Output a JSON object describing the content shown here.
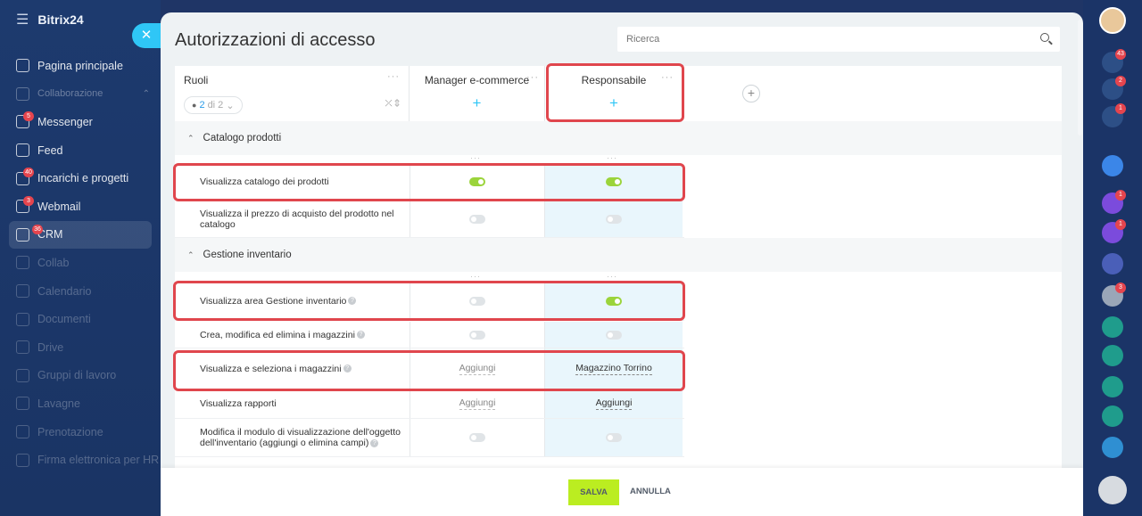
{
  "app": {
    "brand": "Bitrix24"
  },
  "sidebar": {
    "items": [
      {
        "label": "Pagina principale",
        "style": "normal"
      },
      {
        "label": "Collaborazione",
        "style": "section"
      },
      {
        "label": "Messenger",
        "style": "normal",
        "badge": "5"
      },
      {
        "label": "Feed",
        "style": "normal"
      },
      {
        "label": "Incarichi e progetti",
        "style": "normal",
        "badge": "40"
      },
      {
        "label": "Webmail",
        "style": "normal",
        "badge": "3"
      },
      {
        "label": "CRM",
        "style": "active",
        "badge": "36"
      },
      {
        "label": "Collab",
        "style": "dim"
      },
      {
        "label": "Calendario",
        "style": "dim"
      },
      {
        "label": "Documenti",
        "style": "dim"
      },
      {
        "label": "Drive",
        "style": "dim"
      },
      {
        "label": "Gruppi di lavoro",
        "style": "dim"
      },
      {
        "label": "Lavagne",
        "style": "dim"
      },
      {
        "label": "Prenotazione",
        "style": "dim"
      },
      {
        "label": "Firma elettronica per HR",
        "style": "dim"
      }
    ]
  },
  "rail": {
    "buttons": [
      {
        "name": "notifications",
        "badge": "43",
        "color": "#2d4f86"
      },
      {
        "name": "activity",
        "badge": "2",
        "color": "#2d4f86"
      },
      {
        "name": "chat",
        "badge": "1",
        "color": "#2d4f86"
      },
      {
        "name": "bookmark",
        "badge": "",
        "color": "#3b86e8"
      },
      {
        "name": "app-1",
        "badge": "1",
        "color": "#7b4bdc"
      },
      {
        "name": "app-2",
        "badge": "1",
        "color": "#7b4bdc"
      },
      {
        "name": "app-3",
        "badge": "",
        "color": "#4a5fb8"
      },
      {
        "name": "user-avatar",
        "badge": "3",
        "color": "#9aa6b8"
      },
      {
        "name": "task-1",
        "badge": "",
        "color": "#1f9c8c"
      },
      {
        "name": "task-2",
        "badge": "",
        "color": "#1f9c8c"
      },
      {
        "name": "group-1",
        "badge": "",
        "color": "#1f9c8c"
      },
      {
        "name": "group-2",
        "badge": "",
        "color": "#1f9c8c"
      },
      {
        "name": "comments",
        "badge": "",
        "color": "#2f8fd2"
      }
    ]
  },
  "panel": {
    "title": "Autorizzazioni di accesso",
    "search_placeholder": "Ricerca",
    "roles_header": "Ruoli",
    "roles_counter": {
      "current": "2",
      "rest": "di 2"
    },
    "roles": [
      "Manager e-commerce",
      "Responsabile"
    ]
  },
  "sections": [
    {
      "title": "Catalogo prodotti",
      "rows": [
        {
          "label": "Visualizza catalogo dei prodotti",
          "help": false,
          "c1": {
            "type": "toggle",
            "on": true
          },
          "c2": {
            "type": "toggle",
            "on": true
          }
        },
        {
          "label": "Visualizza il prezzo di acquisto del prodotto nel catalogo",
          "help": false,
          "c1": {
            "type": "toggle",
            "on": false
          },
          "c2": {
            "type": "toggle",
            "on": false
          }
        }
      ]
    },
    {
      "title": "Gestione inventario",
      "rows": [
        {
          "label": "Visualizza area Gestione inventario",
          "help": true,
          "c1": {
            "type": "toggle",
            "on": false
          },
          "c2": {
            "type": "toggle",
            "on": true
          }
        },
        {
          "label": "Crea, modifica ed elimina i magazzini",
          "help": true,
          "c1": {
            "type": "toggle",
            "on": false
          },
          "c2": {
            "type": "toggle",
            "on": false
          }
        },
        {
          "label": "Visualizza e seleziona i magazzini",
          "help": true,
          "c1": {
            "type": "link",
            "text": "Aggiungi"
          },
          "c2": {
            "type": "link",
            "text": "Magazzino Torrino",
            "dark": true
          }
        },
        {
          "label": "Visualizza rapporti",
          "help": false,
          "c1": {
            "type": "link",
            "text": "Aggiungi"
          },
          "c2": {
            "type": "link",
            "text": "Aggiungi",
            "dark": true
          }
        },
        {
          "label": "Modifica il modulo di visualizzazione dell'oggetto dell'inventario (aggiungi o elimina campi)",
          "help": true,
          "c1": {
            "type": "toggle",
            "on": false
          },
          "c2": {
            "type": "toggle",
            "on": false
          }
        }
      ]
    }
  ],
  "footer": {
    "save": "SALVA",
    "cancel": "ANNULLA"
  }
}
